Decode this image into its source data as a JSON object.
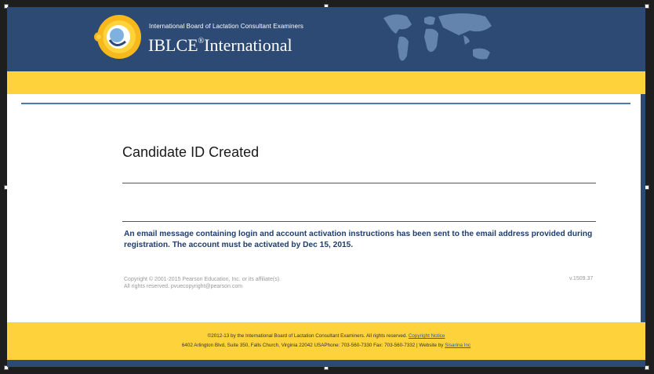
{
  "header": {
    "org_name_small": "International Board of Lactation Consultant Examiners",
    "brand_main": "IBLCE",
    "brand_mark": "®",
    "brand_suffix": "International",
    "logo_icon": "iblce-logo-icon",
    "map_icon": "world-map-icon"
  },
  "main": {
    "title": "Candidate ID Created",
    "message": "An email message containing login and account activation instructions has been sent to the email address provided during registration. The account must be activated by Dec 15, 2015.",
    "copyright_line1": "Copyright © 2001-2015 Pearson Education, Inc. or its affiliate(s).",
    "copyright_line2": "All rights reserved. pvuecopyright@pearson.com",
    "version": "v.1509.37"
  },
  "footer": {
    "line1_text": "©2012-13 by the International Board of Lactation Consultant Examiners. All rights reserved.",
    "line1_link": "Copyright Notice",
    "line2_text": "6402 Arlington Blvd, Suite 350, Falls Church, Virginia 22042 USAPhone: 703-560-7330 Fax: 703-560-7332 | Website by",
    "line2_link": "Sisarina Inc"
  },
  "colors": {
    "header_blue": "#2c4a73",
    "accent_yellow": "#fdd23b",
    "message_blue": "#1f3d6b",
    "rule_blue": "#4a7ab5"
  }
}
